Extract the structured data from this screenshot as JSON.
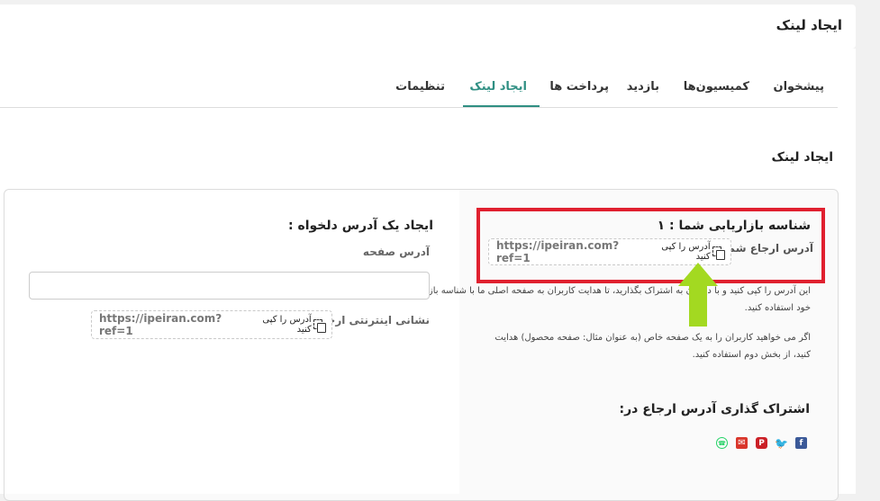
{
  "page": {
    "title": "ایجاد لینک"
  },
  "tabs": [
    {
      "label": "پیشخوان"
    },
    {
      "label": "کمیسیون‌ها"
    },
    {
      "label": "بازدید"
    },
    {
      "label": "پرداخت ها"
    },
    {
      "label": "ایجاد لینک",
      "active": true
    },
    {
      "label": "تنظیمات"
    }
  ],
  "section": {
    "title": "ایجاد لینک"
  },
  "referral": {
    "marketer_id_label": "شناسه بازاریابی شما : ۱",
    "ref_address_label": "آدرس ارجاع شما :",
    "url": "https://ipeiran.com?ref=1",
    "copy_hint": "آدرس را کپی کنید",
    "description_1_line1": "این آدرس را کپی کنید و با دیگران به اشتراک بگذارید، تا هدایت کاربران به صفحه اصلی ما با شناسه بازاریابی",
    "description_1_line2": "خود استفاده کنید.",
    "description_2_line1": "اگر می خواهید کاربران را به یک صفحه خاص (به عنوان مثال: صفحه محصول) هدایت",
    "description_2_line2": "کنید، از بخش دوم استفاده کنید."
  },
  "share": {
    "title": "اشتراک گذاری آدرس ارجاع در:",
    "icons": [
      "facebook-icon",
      "twitter-icon",
      "pinterest-icon",
      "email-icon",
      "whatsapp-icon"
    ],
    "colors": {
      "facebook": "#3b5998",
      "twitter": "#1da1f2",
      "pinterest": "#cb2027",
      "email": "#d9362b",
      "whatsapp": "#25d366"
    }
  },
  "custom": {
    "title": "ایجاد یک آدرس دلخواه :",
    "page_address_label": "آدرس صفحه",
    "page_address_value": "",
    "net_address_label": "نشانی اینترنتی ارجاع",
    "url": "https://ipeiran.com?ref=1",
    "copy_hint": "آدرس را کپی کنید"
  },
  "colors": {
    "accent": "#2f8f83",
    "highlight": "#e0202f",
    "arrow": "#a3d921"
  }
}
